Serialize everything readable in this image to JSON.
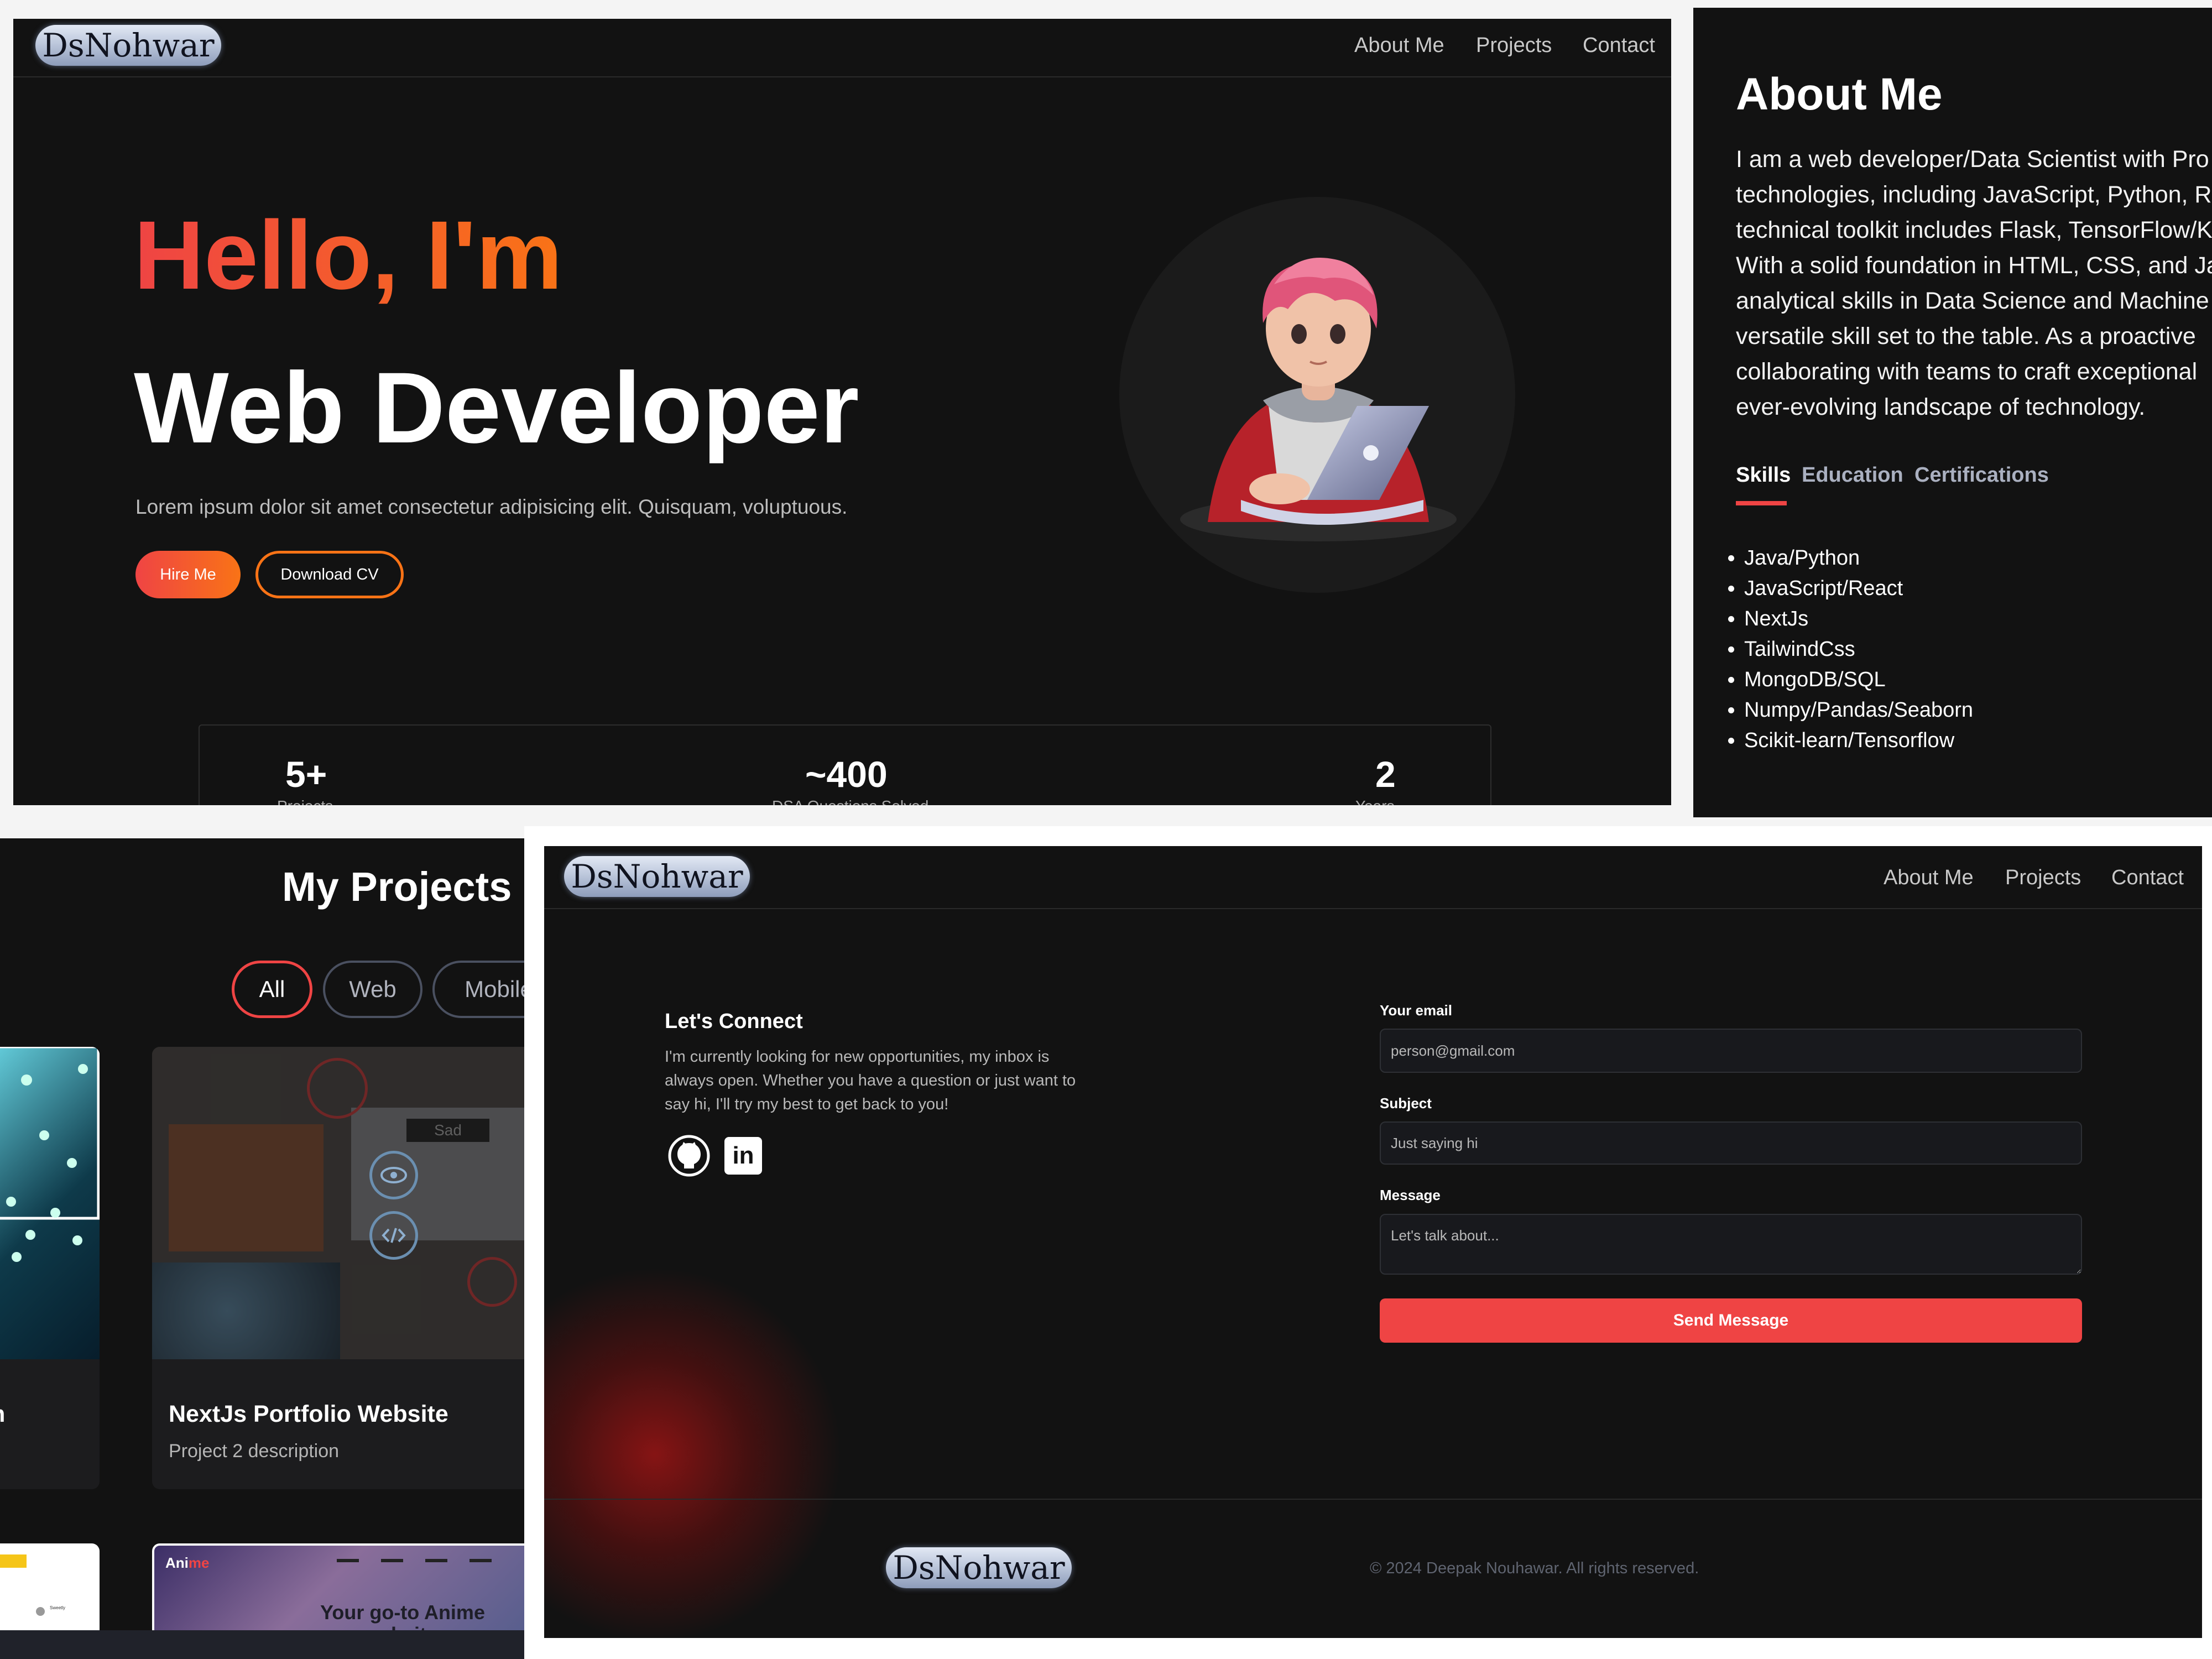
{
  "brand": {
    "logo_text": "DsNohwar"
  },
  "nav": {
    "about": "About Me",
    "projects": "Projects",
    "contact": "Contact"
  },
  "hero": {
    "greeting": "Hello, I'm",
    "role": "Web Developer",
    "description": "Lorem ipsum dolor sit amet consectetur adipisicing elit. Quisquam, voluptuous.",
    "hire_label": "Hire Me",
    "cv_label": "Download CV",
    "stats": [
      {
        "value": "5+",
        "label": "Projects"
      },
      {
        "value": "~400",
        "label": "DSA Questions Solved"
      },
      {
        "value": "2",
        "label": "Years"
      }
    ]
  },
  "about": {
    "title": "About Me",
    "lines": [
      "I am a web developer/Data Scientist with Pro",
      "technologies, including JavaScript, Python, R",
      "technical toolkit includes Flask, TensorFlow/K",
      "With a solid foundation in HTML, CSS, and Ja",
      "analytical skills in Data Science and Machine",
      "versatile skill set to the table. As a proactive",
      "collaborating with teams to craft exceptional",
      "ever-evolving landscape of technology."
    ],
    "tabs": [
      "Skills",
      "Education",
      "Certifications"
    ],
    "skills": [
      "Java/Python",
      "JavaScript/React",
      "NextJs",
      "TailwindCss",
      "MongoDB/SQL",
      "Numpy/Pandas/Seaborn",
      "Scikit-learn/Tensorflow"
    ]
  },
  "projects": {
    "title": "My Projects",
    "filters": [
      "All",
      "Web",
      "Mobile"
    ],
    "card_title": "NextJs Portfolio Website",
    "card_desc": "Project 2 description",
    "left_card_fragment": "m",
    "thumb_badge": "Sad",
    "anime_brand_1": "Ani",
    "anime_brand_2": "me",
    "anime_tagline": "Your go-to Anime",
    "anime_tagline_2": "website",
    "mini_tag": "Sweetly"
  },
  "contact": {
    "heading": "Let's Connect",
    "body_lines": [
      "I'm currently looking for new opportunities, my inbox is",
      "always open. Whether you have a question or just want to",
      "say hi, I'll try my best to get back to you!"
    ],
    "email_label": "Your email",
    "email_placeholder": "person@gmail.com",
    "subject_label": "Subject",
    "subject_placeholder": "Just saying hi",
    "message_label": "Message",
    "message_placeholder": "Let's talk about...",
    "send_label": "Send Message",
    "linkedin_text": "in",
    "copyright": "© 2024 Deepak Nouhawar. All rights reserved."
  },
  "colors": {
    "accent_red": "#ef4444",
    "accent_orange": "#f97316",
    "background": "#121212"
  }
}
